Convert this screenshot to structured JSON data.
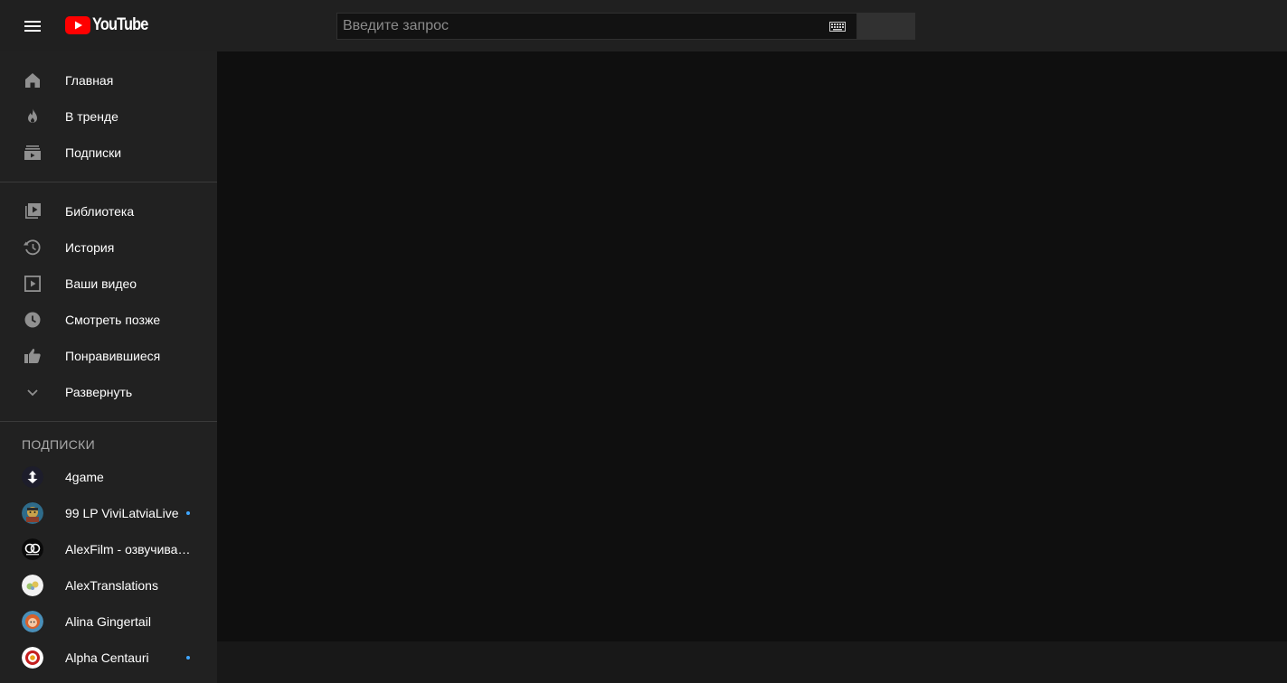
{
  "header": {
    "logo_text": "YouTube",
    "brand_color": "#ff0000",
    "search_placeholder": "Введите запрос"
  },
  "sidebar": {
    "primary": [
      {
        "label": "Главная",
        "icon": "home-icon"
      },
      {
        "label": "В тренде",
        "icon": "trending-icon"
      },
      {
        "label": "Подписки",
        "icon": "subscriptions-icon"
      }
    ],
    "library": [
      {
        "label": "Библиотека",
        "icon": "library-icon"
      },
      {
        "label": "История",
        "icon": "history-icon"
      },
      {
        "label": "Ваши видео",
        "icon": "your-videos-icon"
      },
      {
        "label": "Смотреть позже",
        "icon": "watch-later-icon"
      },
      {
        "label": "Понравившиеся",
        "icon": "liked-icon"
      },
      {
        "label": "Развернуть",
        "icon": "chevron-down-icon"
      }
    ],
    "subscriptions_title": "ПОДПИСКИ",
    "subscriptions": [
      {
        "label": "4game",
        "live": false
      },
      {
        "label": "99 LP ViviLatviaLive",
        "live": true
      },
      {
        "label": "AlexFilm - озвучивае…",
        "live": false
      },
      {
        "label": "AlexTranslations",
        "live": false
      },
      {
        "label": "Alina Gingertail",
        "live": false
      },
      {
        "label": "Alpha Centauri",
        "live": true
      }
    ]
  }
}
